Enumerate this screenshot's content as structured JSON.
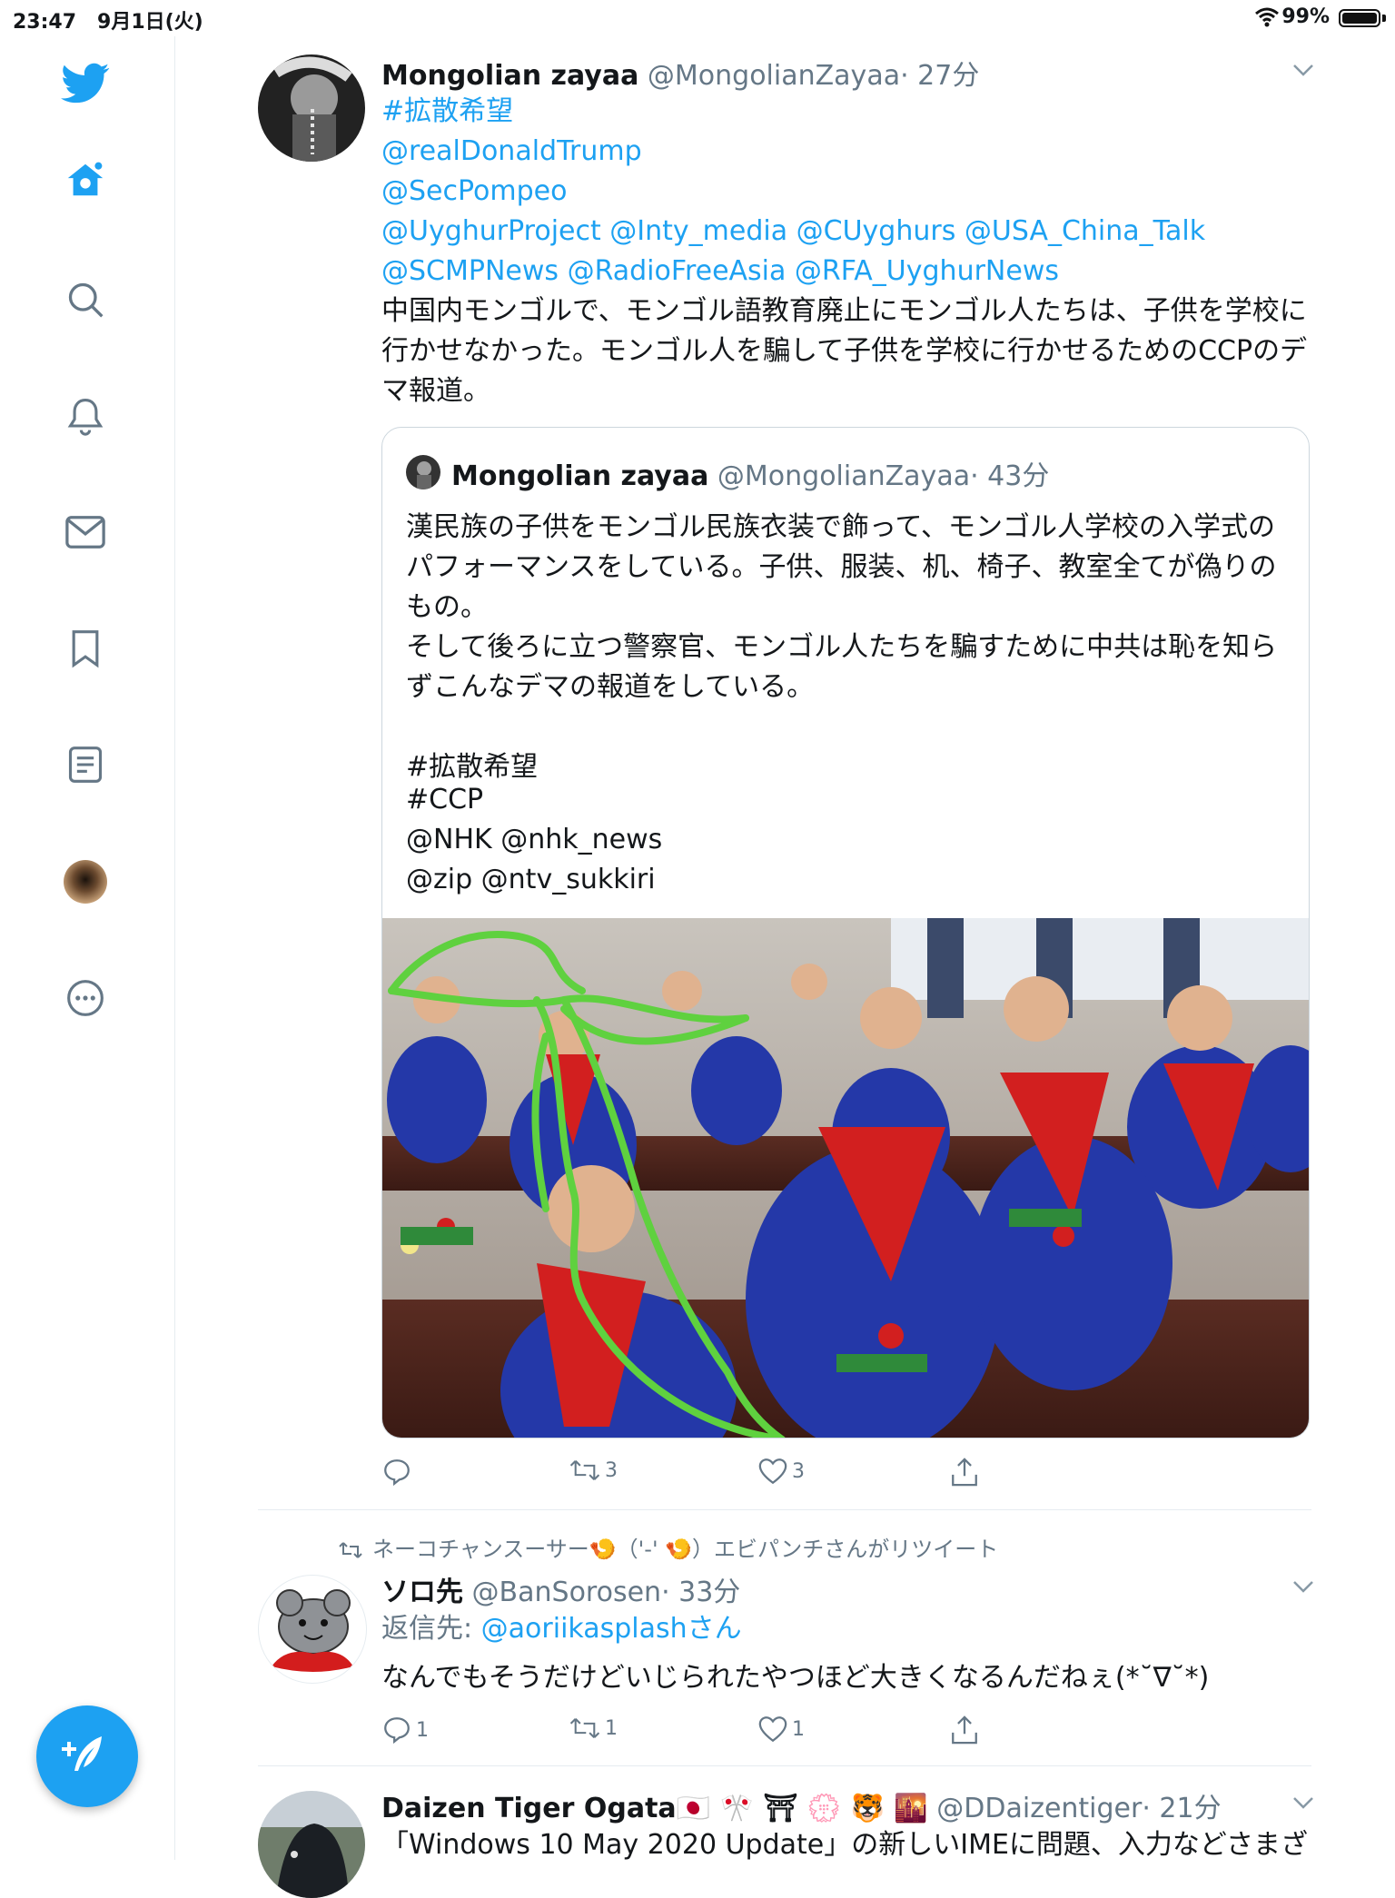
{
  "status": {
    "time": "23:47",
    "date": "9月1日(火)",
    "battery": "99%"
  },
  "tweet1": {
    "name": "Mongolian zayaa",
    "handle": "@MongolianZayaa",
    "time": "· 27分",
    "mentions": [
      "#拡散希望",
      "@realDonaldTrump",
      "@SecPompeo",
      "@UyghurProject @Inty_media @CUyghurs @USA_China_Talk",
      "@SCMPNews @RadioFreeAsia @RFA_UyghurNews"
    ],
    "body": [
      "中国内モンゴルで、モンゴル語教育廃止にモンゴル人たちは、子供を学校に",
      "行かせなかった。モンゴル人を騙して子供を学校に行かせるためのCCPのデ",
      "マ報道。"
    ],
    "quote": {
      "name": "Mongolian zayaa",
      "handle": "@MongolianZayaa",
      "time": "· 43分",
      "lines": [
        "漢民族の子供をモンゴル民族衣装で飾って、モンゴル人学校の入学式の",
        "パフォーマンスをしている。子供、服装、机、椅子、教室全てが偽りの",
        "もの。",
        "そして後ろに立つ警察官、モンゴル人たちを騙すために中共は恥を知ら",
        "ずこんなデマの報道をしている。",
        "",
        "#拡散希望",
        "#CCP",
        "@NHK @nhk_news",
        "@zip @ntv_sukkiri"
      ]
    },
    "retweets": "3",
    "likes": "3"
  },
  "tweet2": {
    "retweeted_by": "ネーコチャンスーサー🍤（'-' 🍤）エビパンチさんがリツイート",
    "name": "ソロ先",
    "handle": "@BanSorosen",
    "time": "· 33分",
    "reply_prefix": "返信先: ",
    "reply_to": "@aoriikasplashさん",
    "body": "なんでもそうだけどいじられたやつほど大きくなるんだねぇ(*˘∇˘*)",
    "replies": "1",
    "retweets": "1",
    "likes": "1"
  },
  "tweet3": {
    "name": "Daizen Tiger Ogata🇯🇵 🎌 ⛩ 💮 🐯 🌇",
    "handle": "@DDaizentiger",
    "time": "· 21分",
    "body": "「Windows 10 May 2020 Update」の新しいIMEに問題、入力などさまざ"
  },
  "colors": {
    "accent": "#1da1f2",
    "secondary": "#657786",
    "annotation": "#5fd13f"
  },
  "icons": [
    "twitter-logo-icon",
    "home-icon",
    "search-icon",
    "notifications-icon",
    "messages-icon",
    "bookmarks-icon",
    "lists-icon",
    "profile-avatar",
    "more-icon",
    "compose-icon",
    "reply-icon",
    "retweet-icon",
    "like-icon",
    "share-icon",
    "chevron-down-icon"
  ]
}
